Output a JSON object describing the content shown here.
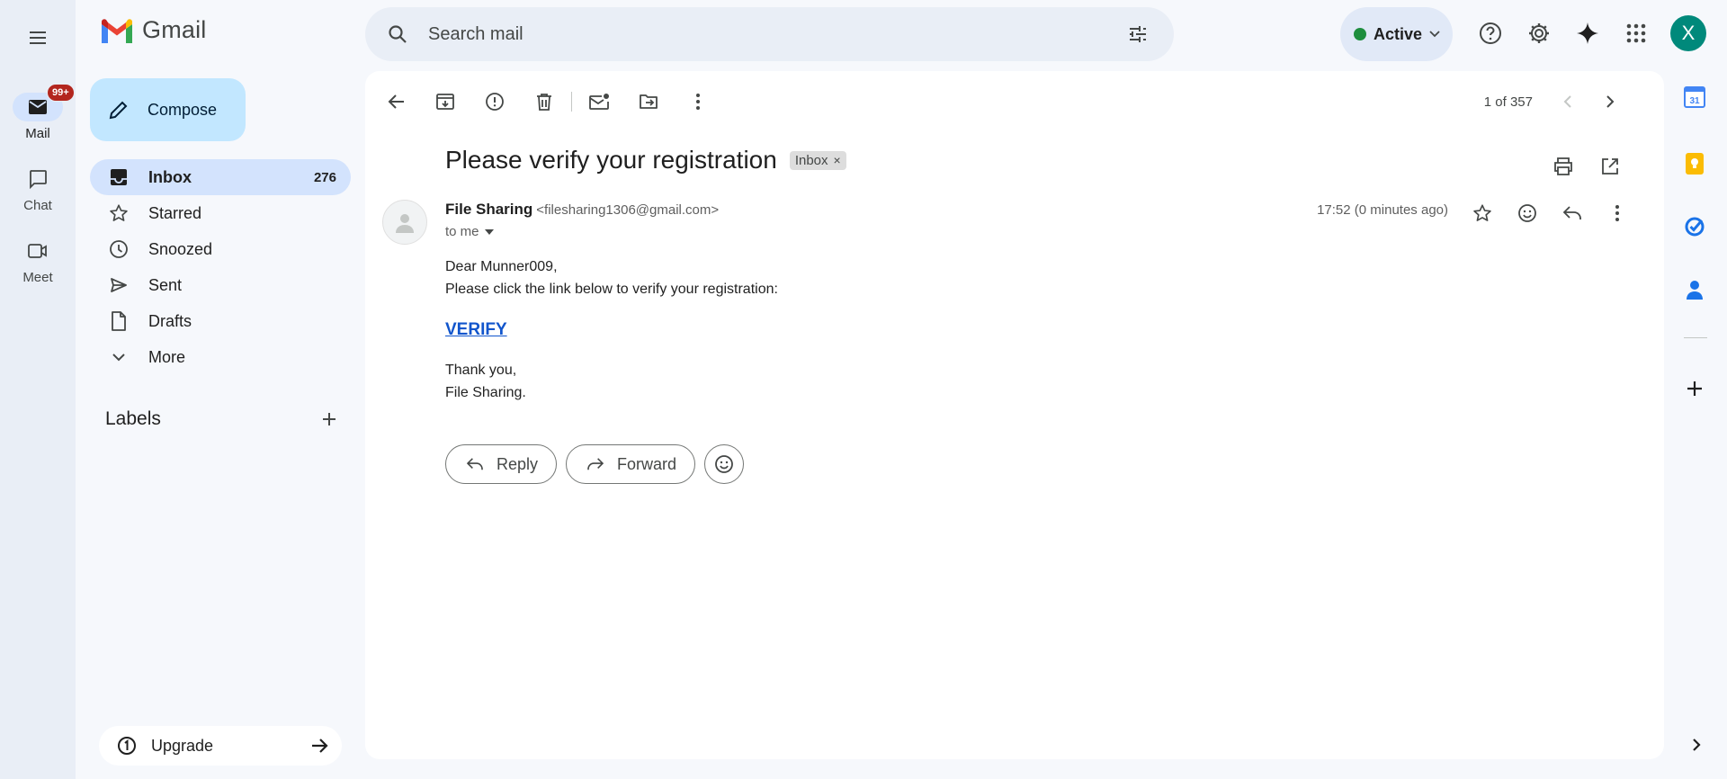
{
  "app": {
    "logo_text": "Gmail",
    "status_label": "Active",
    "avatar_letter": "X"
  },
  "search": {
    "placeholder": "Search mail"
  },
  "rail": {
    "items": [
      {
        "label": "Mail",
        "badge": "99+"
      },
      {
        "label": "Chat"
      },
      {
        "label": "Meet"
      }
    ]
  },
  "nav": {
    "compose_label": "Compose",
    "items": [
      {
        "label": "Inbox",
        "count": "276"
      },
      {
        "label": "Starred"
      },
      {
        "label": "Snoozed"
      },
      {
        "label": "Sent"
      },
      {
        "label": "Drafts"
      },
      {
        "label": "More"
      }
    ],
    "labels_title": "Labels",
    "upgrade_label": "Upgrade"
  },
  "toolbar": {
    "pager_text": "1 of 357"
  },
  "email": {
    "subject": "Please verify your registration",
    "label_chip": "Inbox",
    "sender_name": "File Sharing",
    "sender_email": "<filesharing1306@gmail.com>",
    "to_line": "to me",
    "time": "17:52 (0 minutes ago)",
    "body": {
      "greeting": "Dear Munner009,",
      "line1": "Please click the link below to verify your registration:",
      "link": "VERIFY",
      "closing": "Thank you,",
      "signature": "File Sharing."
    }
  },
  "reply_actions": {
    "reply_label": "Reply",
    "forward_label": "Forward"
  },
  "colors": {
    "background": "#f6f8fc",
    "rail": "#e9eef6",
    "active_nav": "#d3e3fd",
    "compose": "#c2e7ff",
    "link": "#1155cc",
    "status_green": "#1e8e3e",
    "badge_red": "#b3261e",
    "avatar": "#00897b"
  },
  "side_panel": {
    "icons": [
      "calendar-icon",
      "keep-icon",
      "tasks-icon",
      "contacts-icon",
      "add-icon"
    ],
    "calendar_day": "31"
  }
}
